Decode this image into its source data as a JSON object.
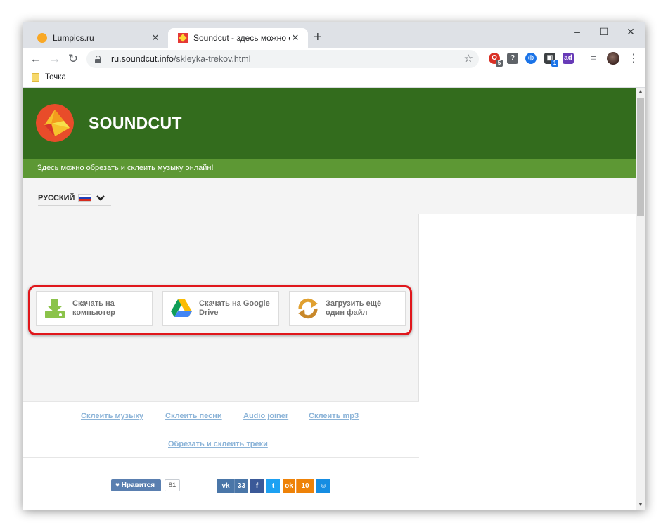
{
  "browser": {
    "tabs": [
      {
        "title": "Lumpics.ru",
        "close": "✕"
      },
      {
        "title": "Soundcut - здесь можно обрезать",
        "close": "✕"
      }
    ],
    "new_tab": "+",
    "window_controls": {
      "minimize": "–",
      "maximize": "☐",
      "close": "✕"
    },
    "url_host": "ru.soundcut.info",
    "url_path": "/skleyka-trekov.html",
    "extensions": [
      {
        "name": "opera-icon",
        "badge": "5",
        "color": "#d93025"
      },
      {
        "name": "help-icon",
        "badge": "",
        "color": "#5f6368"
      },
      {
        "name": "globe-icon",
        "badge": "",
        "color": "#1a73e8"
      },
      {
        "name": "package-icon",
        "badge": "1",
        "color": "#3c4043"
      },
      {
        "name": "ad-icon",
        "badge": "",
        "color": "#673ab7"
      },
      {
        "name": "playlist-icon",
        "badge": "",
        "color": "#5f6368"
      }
    ],
    "bookmark": "Точка"
  },
  "site": {
    "name": "SOUNDCUT",
    "tagline": "Здесь можно обрезать и склеить музыку онлайн!",
    "language": "РУССКИЙ"
  },
  "download": {
    "buttons": [
      {
        "label_line1": "Скачать на",
        "label_line2": "компьютер",
        "icon": "download-computer-icon"
      },
      {
        "label_line1": "Скачать на Google",
        "label_line2": "Drive",
        "icon": "google-drive-icon"
      },
      {
        "label_line1": "Загрузить ещё",
        "label_line2": "один файл",
        "icon": "reload-icon"
      }
    ]
  },
  "links": [
    "Склеить музыку",
    "Склеить песни",
    "Audio joiner",
    "Склеить mp3",
    "Обрезать и склеить треки"
  ],
  "social": {
    "like_label": "♥ Нравится",
    "like_count": "81",
    "vk_count": "33",
    "ok_count": "10",
    "colors": {
      "vk": "#4a76a8",
      "fb": "#3b5998",
      "tw": "#1da1f2",
      "ok": "#ee8208",
      "mm": "#168de2"
    }
  }
}
